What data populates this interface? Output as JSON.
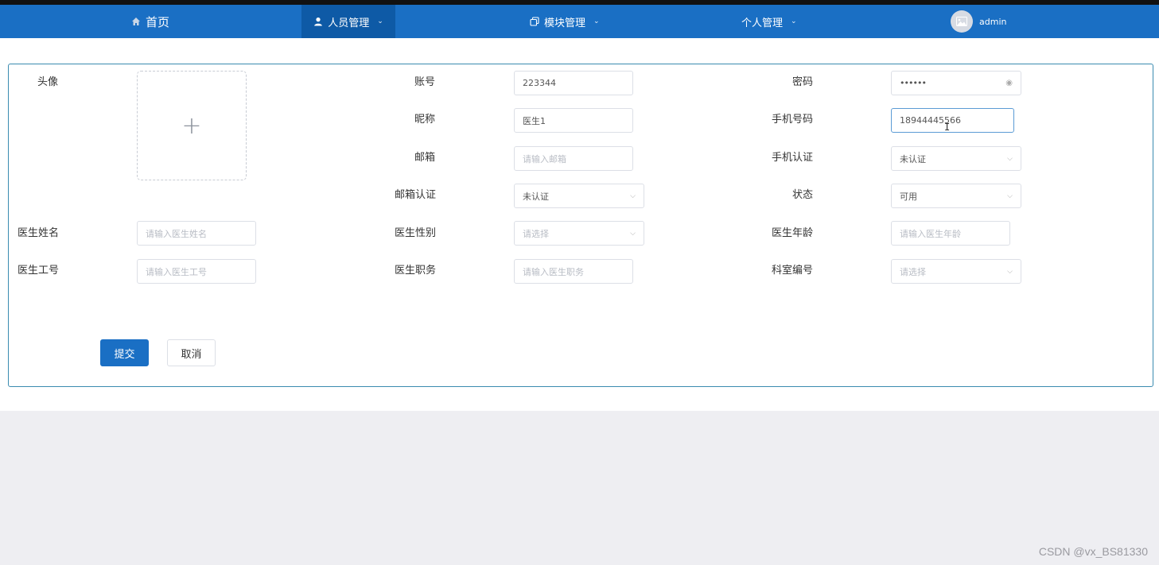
{
  "nav": {
    "home": "首页",
    "people": "人员管理",
    "module": "模块管理",
    "personal": "个人管理",
    "user": "admin"
  },
  "form": {
    "avatar_label": "头像",
    "account_label": "账号",
    "account_value": "223344",
    "password_label": "密码",
    "password_value": "••••••",
    "nickname_label": "昵称",
    "nickname_value": "医生1",
    "phone_label": "手机号码",
    "phone_value": "18944445566",
    "email_label": "邮箱",
    "email_placeholder": "请输入邮箱",
    "phone_auth_label": "手机认证",
    "phone_auth_value": "未认证",
    "email_auth_label": "邮箱认证",
    "email_auth_value": "未认证",
    "status_label": "状态",
    "status_value": "可用",
    "doctor_name_label": "医生姓名",
    "doctor_name_placeholder": "请输入医生姓名",
    "gender_label": "医生性别",
    "gender_placeholder": "请选择",
    "age_label": "医生年龄",
    "age_placeholder": "请输入医生年龄",
    "job_no_label": "医生工号",
    "job_no_placeholder": "请输入医生工号",
    "position_label": "医生职务",
    "position_placeholder": "请输入医生职务",
    "dept_label": "科室编号",
    "dept_placeholder": "请选择",
    "submit": "提交",
    "cancel": "取消"
  },
  "watermark": "CSDN @vx_BS81330",
  "colors": {
    "nav_bg": "#1a6fc4",
    "nav_active": "#0e5aa6",
    "primary": "#1a6fc4",
    "card_border": "#3a8bb0"
  }
}
